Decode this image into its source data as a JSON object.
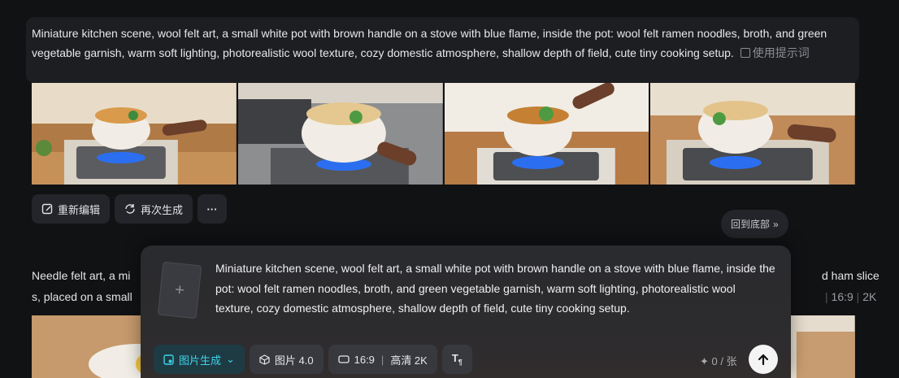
{
  "top_prompt": {
    "text": "Miniature kitchen scene, wool felt art, a small white pot with brown handle on a stove with blue flame, inside the pot: wool felt ramen noodles, broth, and green vegetable garnish, warm soft lighting, photorealistic wool texture, cozy domestic atmosphere, shallow depth of field, cute tiny cooking setup.",
    "use_prompt_label": "使用提示词"
  },
  "actions": {
    "reedit_label": "重新编辑",
    "regenerate_label": "再次生成",
    "more_label": "···"
  },
  "back_to_bottom_label": "回到底部",
  "second_prompt": {
    "line1_left": "Needle felt art, a mi",
    "line2_left": "s, placed on a small",
    "line1_right": "d ham slice",
    "meta_ratio": "16:9",
    "meta_res": "2K"
  },
  "composer": {
    "add_symbol": "+",
    "text": "Miniature kitchen scene, wool felt art, a small white pot with brown handle on a stove with blue flame, inside the pot: wool felt ramen noodles, broth, and green vegetable garnish, warm soft lighting, photorealistic wool texture, cozy domestic atmosphere, shallow depth of field, cute tiny cooking setup.",
    "mode_label": "图片生成",
    "model_label": "图片 4.0",
    "ratio_label": "16:9",
    "quality_label": "高清 2K",
    "counter": "0 / 张"
  },
  "colors": {
    "accent": "#3ed3e8",
    "background": "#111214"
  }
}
